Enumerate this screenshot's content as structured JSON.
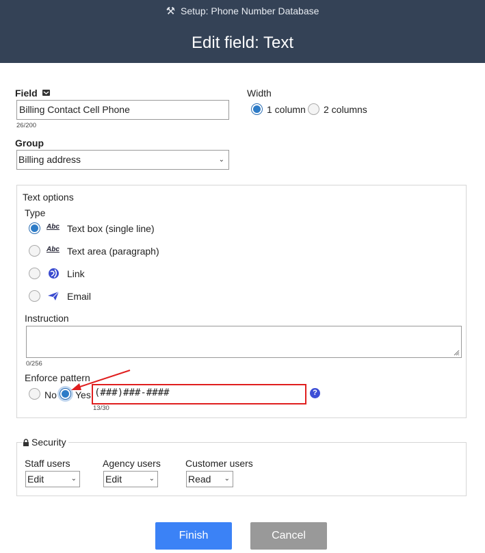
{
  "header": {
    "subtitle": "Setup: Phone Number Database",
    "title": "Edit field: Text"
  },
  "field": {
    "label": "Field",
    "value": "Billing Contact Cell Phone",
    "count": "26/200"
  },
  "width": {
    "label": "Width",
    "option1": "1 column",
    "option2": "2 columns",
    "selected": "1 column"
  },
  "group": {
    "label": "Group",
    "value": "Billing address"
  },
  "text_options": {
    "legend": "Text options",
    "type_label": "Type",
    "types": [
      {
        "label": "Text box (single line)",
        "icon": "abc-textbox-icon",
        "selected": true
      },
      {
        "label": "Text area (paragraph)",
        "icon": "abc-textarea-icon",
        "selected": false
      },
      {
        "label": "Link",
        "icon": "globe-link-icon",
        "selected": false
      },
      {
        "label": "Email",
        "icon": "paper-plane-icon",
        "selected": false
      }
    ],
    "abc_glyph": "Abc",
    "instruction_label": "Instruction",
    "instruction_value": "",
    "instruction_count": "0/256",
    "enforce_label": "Enforce pattern",
    "enforce_no": "No",
    "enforce_yes": "Yes",
    "enforce_selected": "Yes",
    "pattern_value": "(###)###-####",
    "pattern_count": "13/30",
    "help_glyph": "?"
  },
  "security": {
    "legend": "Security",
    "staff_label": "Staff users",
    "staff_value": "Edit",
    "agency_label": "Agency users",
    "agency_value": "Edit",
    "customer_label": "Customer users",
    "customer_value": "Read"
  },
  "buttons": {
    "finish": "Finish",
    "cancel": "Cancel"
  },
  "colors": {
    "header_bg": "#344256",
    "finish_bg": "#3b82f6",
    "cancel_bg": "#999999",
    "annotation": "#e01e1e",
    "radio_selected": "#2e7cc7"
  }
}
